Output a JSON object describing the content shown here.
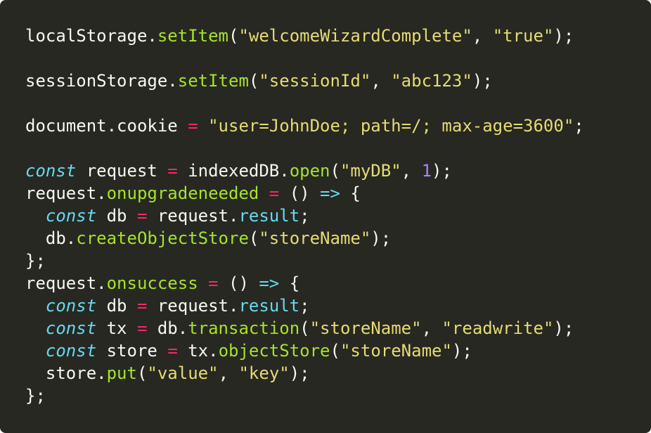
{
  "colors": {
    "background": "#272822",
    "text": "#f8f8f2",
    "keyword": "#66d9ef",
    "function": "#a6e22e",
    "string": "#e6db74",
    "operator": "#f92672",
    "number": "#ae81ff"
  },
  "lines": [
    [
      {
        "t": "localStorage."
      },
      {
        "t": "setItem",
        "c": "fn"
      },
      {
        "t": "("
      },
      {
        "t": "\"welcomeWizardComplete\"",
        "c": "str"
      },
      {
        "t": ", "
      },
      {
        "t": "\"true\"",
        "c": "str"
      },
      {
        "t": ");"
      }
    ],
    [],
    [
      {
        "t": "sessionStorage."
      },
      {
        "t": "setItem",
        "c": "fn"
      },
      {
        "t": "("
      },
      {
        "t": "\"sessionId\"",
        "c": "str"
      },
      {
        "t": ", "
      },
      {
        "t": "\"abc123\"",
        "c": "str"
      },
      {
        "t": ");"
      }
    ],
    [],
    [
      {
        "t": "document.cookie "
      },
      {
        "t": "=",
        "c": "op"
      },
      {
        "t": " "
      },
      {
        "t": "\"user=JohnDoe; path=/; max-age=3600\"",
        "c": "str"
      },
      {
        "t": ";"
      }
    ],
    [],
    [
      {
        "t": "const",
        "c": "kw"
      },
      {
        "t": " request "
      },
      {
        "t": "=",
        "c": "op"
      },
      {
        "t": " indexedDB."
      },
      {
        "t": "open",
        "c": "fn"
      },
      {
        "t": "("
      },
      {
        "t": "\"myDB\"",
        "c": "str"
      },
      {
        "t": ", "
      },
      {
        "t": "1",
        "c": "num"
      },
      {
        "t": ");"
      }
    ],
    [
      {
        "t": "request."
      },
      {
        "t": "onupgradeneeded",
        "c": "fn"
      },
      {
        "t": " "
      },
      {
        "t": "=",
        "c": "op"
      },
      {
        "t": " () "
      },
      {
        "t": "=>",
        "c": "arrow"
      },
      {
        "t": " {"
      }
    ],
    [
      {
        "t": "  "
      },
      {
        "t": "const",
        "c": "kw"
      },
      {
        "t": " db "
      },
      {
        "t": "=",
        "c": "op"
      },
      {
        "t": " request."
      },
      {
        "t": "result",
        "c": "prop"
      },
      {
        "t": ";"
      }
    ],
    [
      {
        "t": "  db."
      },
      {
        "t": "createObjectStore",
        "c": "fn"
      },
      {
        "t": "("
      },
      {
        "t": "\"storeName\"",
        "c": "str"
      },
      {
        "t": ");"
      }
    ],
    [
      {
        "t": "};"
      }
    ],
    [
      {
        "t": "request."
      },
      {
        "t": "onsuccess",
        "c": "fn"
      },
      {
        "t": " "
      },
      {
        "t": "=",
        "c": "op"
      },
      {
        "t": " () "
      },
      {
        "t": "=>",
        "c": "arrow"
      },
      {
        "t": " {"
      }
    ],
    [
      {
        "t": "  "
      },
      {
        "t": "const",
        "c": "kw"
      },
      {
        "t": " db "
      },
      {
        "t": "=",
        "c": "op"
      },
      {
        "t": " request."
      },
      {
        "t": "result",
        "c": "prop"
      },
      {
        "t": ";"
      }
    ],
    [
      {
        "t": "  "
      },
      {
        "t": "const",
        "c": "kw"
      },
      {
        "t": " tx "
      },
      {
        "t": "=",
        "c": "op"
      },
      {
        "t": " db."
      },
      {
        "t": "transaction",
        "c": "fn"
      },
      {
        "t": "("
      },
      {
        "t": "\"storeName\"",
        "c": "str"
      },
      {
        "t": ", "
      },
      {
        "t": "\"readwrite\"",
        "c": "str"
      },
      {
        "t": ");"
      }
    ],
    [
      {
        "t": "  "
      },
      {
        "t": "const",
        "c": "kw"
      },
      {
        "t": " store "
      },
      {
        "t": "=",
        "c": "op"
      },
      {
        "t": " tx."
      },
      {
        "t": "objectStore",
        "c": "fn"
      },
      {
        "t": "("
      },
      {
        "t": "\"storeName\"",
        "c": "str"
      },
      {
        "t": ");"
      }
    ],
    [
      {
        "t": "  store."
      },
      {
        "t": "put",
        "c": "fn"
      },
      {
        "t": "("
      },
      {
        "t": "\"value\"",
        "c": "str"
      },
      {
        "t": ", "
      },
      {
        "t": "\"key\"",
        "c": "str"
      },
      {
        "t": ");"
      }
    ],
    [
      {
        "t": "};"
      }
    ]
  ]
}
